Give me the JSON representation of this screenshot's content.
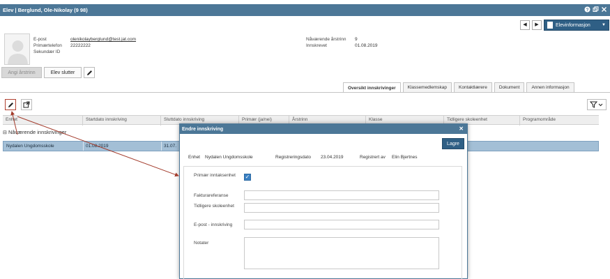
{
  "window": {
    "title": "Elev | Berglund, Ole-Nikolay (9 98)",
    "title_prefix": "Elev | ",
    "title_name": "Berglund, Ole-Nikolay (9 98)"
  },
  "header_nav": {
    "prev_label": "◀",
    "next_label": "▶",
    "elevinfo_label": "Elevinformasjon"
  },
  "student": {
    "email_label": "E-post",
    "email_value": "olenikolayberglund@test.jat.com",
    "phone_label": "Primærtelefon",
    "phone_value": "22222222",
    "secondary_id_label": "Sekundær ID",
    "secondary_id_value": "",
    "current_year_label": "Nåværende årstrinn",
    "current_year_value": "9",
    "enrolled_label": "Innskrevet",
    "enrolled_value": "01.08.2019"
  },
  "actions": {
    "angi_arstrinn": "Angi årstrinn",
    "elev_slutter": "Elev slutter"
  },
  "tabs": [
    {
      "label": "Oversikt innskrivinger",
      "active": true
    },
    {
      "label": "Klassemedlemskap",
      "active": false
    },
    {
      "label": "Kontaktlærere",
      "active": false
    },
    {
      "label": "Dokument",
      "active": false
    },
    {
      "label": "Annen informasjon",
      "active": false
    }
  ],
  "grid": {
    "columns": [
      "Enhet",
      "Startdato innskriving",
      "Sluttdato innskriving",
      "Primær (ja/nei)",
      "Årstrinn",
      "Klasse",
      "Tidligere skoleenhet",
      "Programområde"
    ],
    "group_label": "Nåværende innskrivinger",
    "row": {
      "enhet": "Nydalen Ungdomsskole",
      "startdato": "01.08.2019",
      "sluttdato": "31.07."
    }
  },
  "modal": {
    "title": "Endre innskriving",
    "save_label": "Lagre",
    "enhet_label": "Enhet",
    "enhet_value": "Nydalen Ungdomsskole",
    "regdate_label": "Registreringsdato",
    "regdate_value": "23.04.2019",
    "regby_label": "Registrert av",
    "regby_value": "Elin Bjertnes",
    "fields": {
      "primar_label": "Primær inntaksenhet",
      "faktura_label": "Fakturareferanse",
      "tidligere_label": "Tidligere skoleenhet",
      "epost_label": "E-post - innskriving",
      "notater_label": "Notater"
    },
    "primar_checked": true
  },
  "colors": {
    "header_blue": "#4c7797",
    "button_blue": "#2f5f85",
    "selected_row": "#a3bfd6",
    "arrow_red": "#a33b2b"
  }
}
